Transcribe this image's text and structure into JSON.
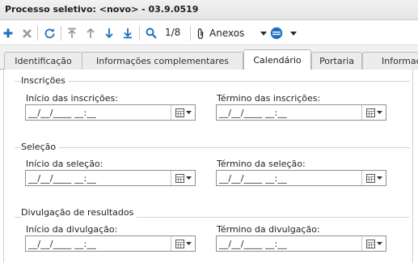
{
  "window": {
    "title": "Processo seletivo: <novo> - 03.9.0519"
  },
  "toolbar": {
    "buttons": [
      {
        "name": "add-button",
        "icon": "plus-icon",
        "color": "#1f6fc1"
      },
      {
        "name": "delete-button",
        "icon": "close-icon",
        "color": "#9a9a9a"
      },
      {
        "name": "refresh-button",
        "icon": "refresh-icon",
        "color": "#1f6fc1"
      },
      {
        "name": "first-record-button",
        "icon": "arrow-first-icon",
        "color": "#9a9a9a"
      },
      {
        "name": "previous-record-button",
        "icon": "arrow-up-icon",
        "color": "#9a9a9a"
      },
      {
        "name": "next-record-button",
        "icon": "arrow-down-icon",
        "color": "#1f6fc1"
      },
      {
        "name": "last-record-button",
        "icon": "arrow-last-icon",
        "color": "#1f6fc1"
      },
      {
        "name": "search-button",
        "icon": "search-icon",
        "color": "#1f6fc1"
      }
    ],
    "pager": "1/8",
    "anexos_label": "Anexos",
    "attachment_icon": "paperclip-icon",
    "extra_icon": "view-mode-icon"
  },
  "tabs": [
    {
      "label": "Identificação",
      "active": false
    },
    {
      "label": "Informações complementares",
      "active": false
    },
    {
      "label": "Calendário",
      "active": true
    },
    {
      "label": "Portaria",
      "active": false
    },
    {
      "label": "Informaçõ",
      "active": false
    }
  ],
  "sections": [
    {
      "legend": "Inscrições",
      "fields": [
        {
          "label": "Início das inscrições:",
          "value": "__/__/____ __:__"
        },
        {
          "label": "Término das inscrições:",
          "value": "__/__/____ __:__"
        }
      ]
    },
    {
      "legend": "Seleção",
      "fields": [
        {
          "label": "Início da seleção:",
          "value": "__/__/____ __:__"
        },
        {
          "label": "Término da seleção:",
          "value": "__/__/____ __:__"
        }
      ]
    },
    {
      "legend": "Divulgação de resultados",
      "fields": [
        {
          "label": "Início da divulgação:",
          "value": "__/__/____ __:__"
        },
        {
          "label": "Término da divulgação:",
          "value": "__/__/____ __:__"
        }
      ]
    }
  ],
  "colors": {
    "accent": "#1f6fc1",
    "disabled": "#9a9a9a"
  }
}
